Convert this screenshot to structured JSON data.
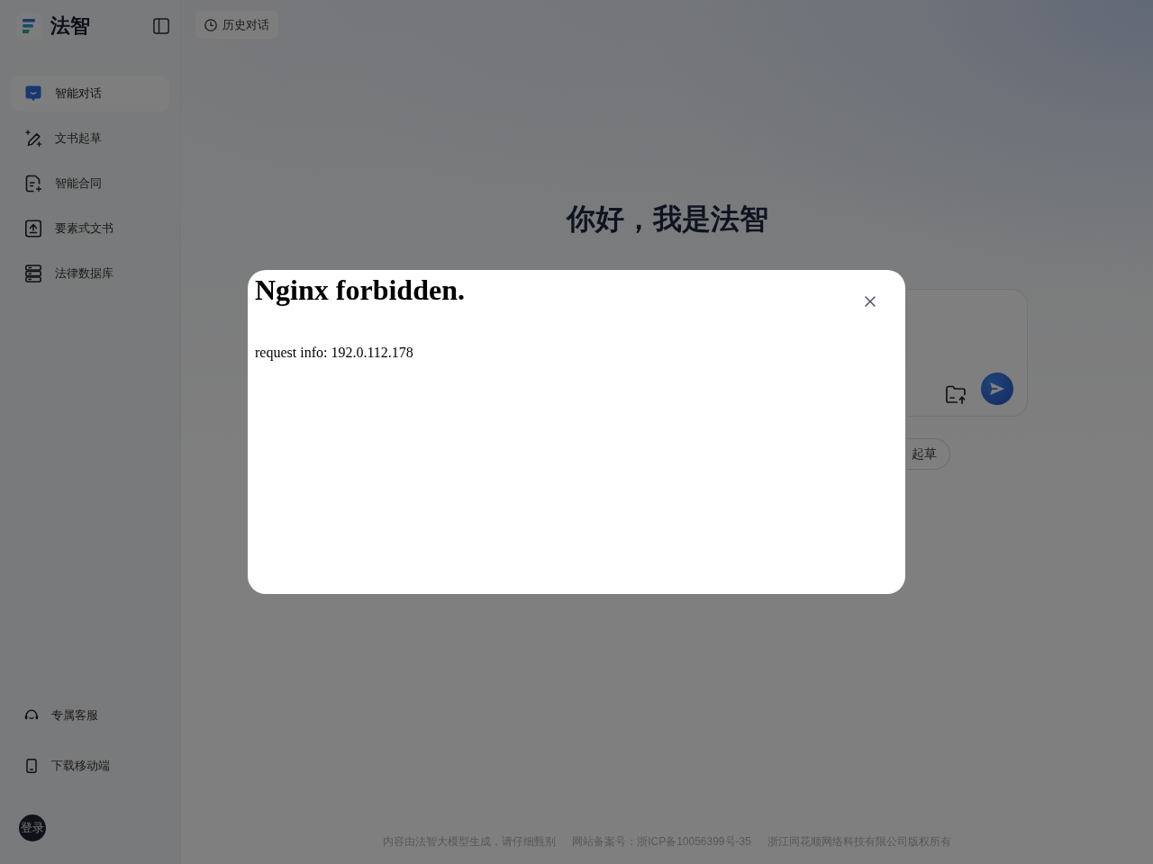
{
  "sidebar": {
    "app_name": "法智",
    "nav_items": [
      {
        "label": "智能对话",
        "selected": true
      },
      {
        "label": "文书起草",
        "selected": false
      },
      {
        "label": "智能合同",
        "selected": false
      },
      {
        "label": "要素式文书",
        "selected": false
      },
      {
        "label": "法律数据库",
        "selected": false
      }
    ],
    "bottom_items": [
      {
        "label": "专属客服"
      },
      {
        "label": "下载移动端"
      }
    ],
    "login_button": "登录"
  },
  "top_bar": {
    "history_button": "历史对话"
  },
  "greeting": "你好，我是法智",
  "suggestion_chips": [
    {
      "label": "起草"
    }
  ],
  "footer": {
    "disclaimer": "内容由法智大模型生成，请仔细甄别",
    "icp_record": "网站备案号：浙ICP备10056399号-35",
    "copyright": "浙江同花顺网络科技有限公司版权所有"
  },
  "dialog": {
    "title": "Nginx forbidden.",
    "message": "request info: 192.0.112.178"
  }
}
